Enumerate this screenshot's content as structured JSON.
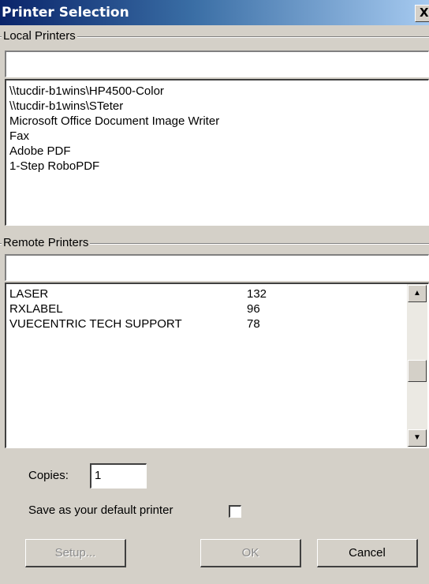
{
  "window": {
    "title": "Printer Selection",
    "close_glyph": "X"
  },
  "local": {
    "group_label": "Local Printers",
    "filter_value": "",
    "items": [
      "\\\\tucdir-b1wins\\HP4500-Color",
      "\\\\tucdir-b1wins\\STeter",
      "Microsoft Office Document Image Writer",
      "Fax",
      "Adobe PDF",
      "1-Step RoboPDF"
    ]
  },
  "remote": {
    "group_label": "Remote Printers",
    "filter_value": "",
    "items": [
      {
        "name": "LASER",
        "count": "132"
      },
      {
        "name": "RXLABEL",
        "count": "96"
      },
      {
        "name": "VUECENTRIC TECH SUPPORT",
        "count": "78"
      }
    ]
  },
  "copies": {
    "label": "Copies:",
    "value": "1"
  },
  "default_printer": {
    "label": "Save as your default printer",
    "checked": false
  },
  "buttons": {
    "setup": "Setup...",
    "ok": "OK",
    "cancel": "Cancel"
  }
}
